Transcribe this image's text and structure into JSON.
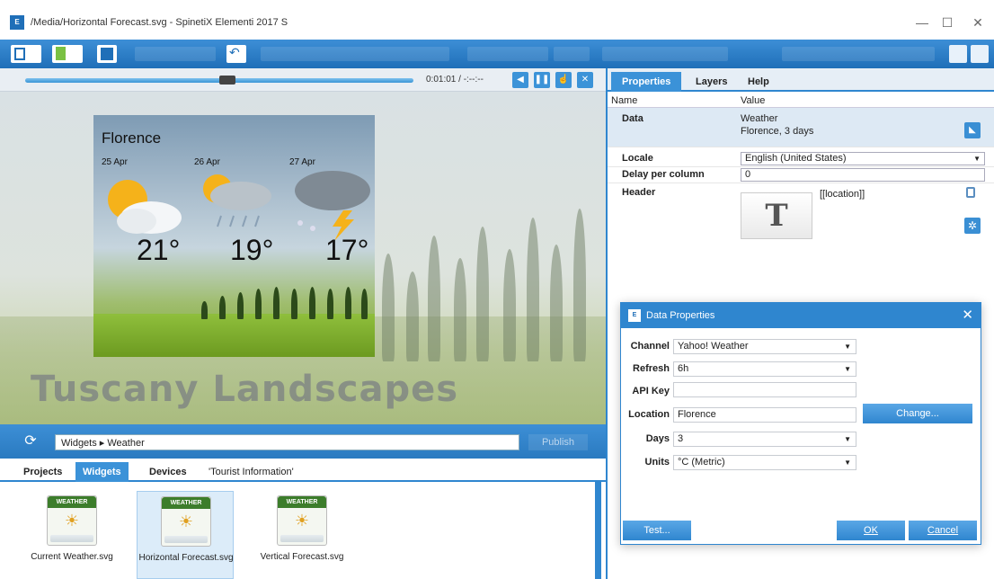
{
  "window": {
    "title": "/Media/Horizontal Forecast.svg - SpinetiX Elementi 2017 S",
    "app_icon_text": "E"
  },
  "player": {
    "time": "0:01:01 / -:--:--",
    "progress": 0.52
  },
  "weather_widget": {
    "city": "Florence",
    "days": [
      {
        "date": "25 Apr",
        "temp": "21°",
        "icon": "sun-cloud-icon"
      },
      {
        "date": "26 Apr",
        "temp": "19°",
        "icon": "rain-icon"
      },
      {
        "date": "27 Apr",
        "temp": "17°",
        "icon": "storm-icon"
      }
    ]
  },
  "banner": "Tuscany Landscapes",
  "widgets_bar": {
    "path": "Widgets ▸ Weather",
    "publish_label": "Publish"
  },
  "bottom_tabs": [
    "Projects",
    "Widgets",
    "Devices",
    "'Tourist Information'"
  ],
  "gallery": [
    {
      "label": "Current Weather.svg",
      "badge": "WEATHER"
    },
    {
      "label": "Horizontal Forecast.svg",
      "badge": "WEATHER"
    },
    {
      "label": "Vertical Forecast.svg",
      "badge": "WEATHER"
    }
  ],
  "right_tabs": [
    "Properties",
    "Layers",
    "Help"
  ],
  "props": {
    "col_name": "Name",
    "col_value": "Value",
    "data": {
      "name": "Data",
      "line1": "Weather",
      "line2": "Florence, 3 days"
    },
    "locale": {
      "name": "Locale",
      "value": "English (United States)"
    },
    "delay": {
      "name": "Delay per column",
      "value": "0"
    },
    "header": {
      "name": "Header",
      "value": "[[location]]",
      "button": "T"
    }
  },
  "dialog": {
    "title": "Data Properties",
    "channel": {
      "label": "Channel",
      "value": "Yahoo! Weather"
    },
    "refresh": {
      "label": "Refresh",
      "value": "6h"
    },
    "apikey": {
      "label": "API Key",
      "value": ""
    },
    "location": {
      "label": "Location",
      "value": "Florence"
    },
    "change_label": "Change...",
    "days": {
      "label": "Days",
      "value": "3"
    },
    "units": {
      "label": "Units",
      "value": "°C (Metric)"
    },
    "test_label": "Test...",
    "ok_label": "OK",
    "cancel_label": "Cancel"
  }
}
